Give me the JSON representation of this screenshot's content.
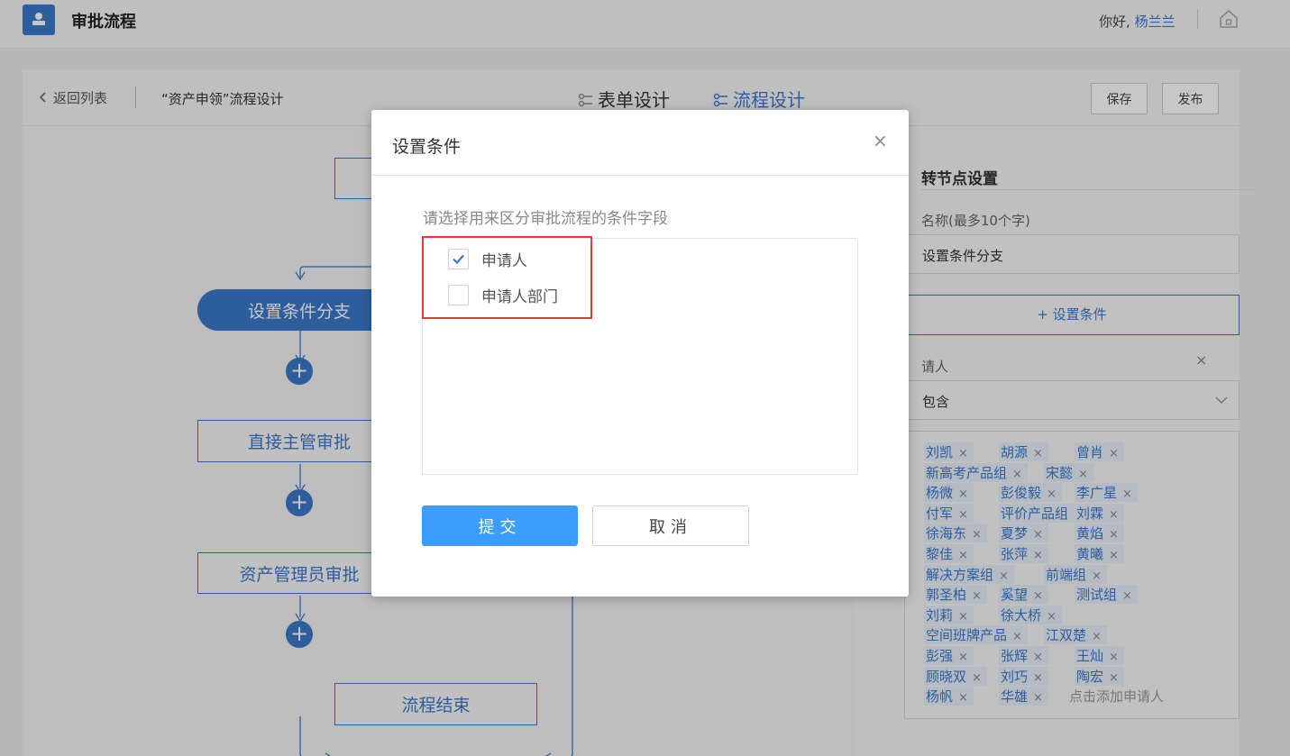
{
  "app": {
    "title": "审批流程",
    "greeting": "你好,",
    "user": "杨兰兰"
  },
  "subheader": {
    "back_label": "返回列表",
    "flow_name": "“资产申领”流程设计",
    "tabs": [
      {
        "label": "表单设计"
      },
      {
        "label": "流程设计"
      }
    ],
    "save_label": "保存",
    "publish_label": "发布"
  },
  "canvas": {
    "nodes": {
      "condition_branch": "设置条件分支",
      "direct_manager": "直接主管审批",
      "asset_admin": "资产管理员审批",
      "end": "流程结束"
    },
    "add_symbol": "+"
  },
  "side": {
    "title": "转节点设置",
    "name_label": "名称(最多10个字)",
    "name_value": "设置条件分支",
    "set_condition_btn": "+ 设置条件",
    "condition_field": "请人",
    "condition_close": "×",
    "operator_value": "包含",
    "tags": [
      [
        "刘凯",
        "胡源",
        "曾肖"
      ],
      [
        "新高考产品组",
        "宋懿"
      ],
      [
        "杨微",
        "彭俊毅",
        "李广星"
      ],
      [
        "付军",
        "评价产品组",
        "刘霖"
      ],
      [
        "徐海东",
        "夏梦",
        "黄焰"
      ],
      [
        "黎佳",
        "张萍",
        "黄曦"
      ],
      [
        "解决方案组",
        "前端组"
      ],
      [
        "郭圣柏",
        "奚望",
        "测试组"
      ],
      [
        "刘莉",
        "徐大桥"
      ],
      [
        "空间班牌产品",
        "江双楚"
      ],
      [
        "彭强",
        "张辉",
        "王灿"
      ],
      [
        "顾晓双",
        "刘巧",
        "陶宏"
      ],
      [
        "杨帆",
        "华雄"
      ]
    ],
    "tag_remove": "×",
    "add_applicant_placeholder": "点击添加申请人"
  },
  "modal": {
    "title": "设置条件",
    "close_symbol": "×",
    "prompt": "请选择用来区分审批流程的条件字段",
    "options": [
      {
        "label": "申请人",
        "checked": true
      },
      {
        "label": "申请人部门",
        "checked": false
      }
    ],
    "submit_label": "提交",
    "cancel_label": "取消"
  },
  "colors": {
    "primary": "#3a78c9",
    "submit": "#3c9dff",
    "highlight": "#e53935"
  }
}
